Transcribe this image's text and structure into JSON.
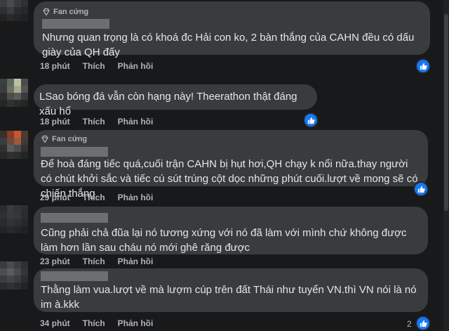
{
  "comments": [
    {
      "badge": "Fan cứng",
      "text": "Nhưng quan trọng là có khoá đc Hải con ko, 2 bàn thắng của CAHN đều có dấu giày của QH đấy",
      "time": "18 phút",
      "like": "Thích",
      "reply": "Phản hồi",
      "reactions": ""
    },
    {
      "badge": "",
      "text": "LSao bóng đá vẫn còn hạng này! Theerathon thật đáng xấu hổ",
      "time": "18 phút",
      "like": "Thích",
      "reply": "Phản hồi",
      "reactions": ""
    },
    {
      "badge": "Fan cứng",
      "text": "Để hoà đáng tiếc quá,cuối trận CAHN bị hụt hơi,QH chạy k nổi nữa.thay người có chút khởi sắc và tiếc cú sút trúng cột dọc những phút cuối.lượt về mong sẽ có chiến thắng",
      "time": "29 phút",
      "like": "Thích",
      "reply": "Phản hồi",
      "reactions": ""
    },
    {
      "badge": "",
      "text": "Cũng phải chả đũa lại nó tương xứng với nó đã làm với mình chứ không được làm hơn lần sau cháu nó mới ghê răng được",
      "time": "23 phút",
      "like": "Thích",
      "reply": "Phản hồi",
      "reactions": ""
    },
    {
      "badge": "",
      "text": "Thằng làm vua.lượt về mà lượm cúp trên đất Thái như tuyển VN.thì VN nói là nó im à.kkk",
      "time": "34 phút",
      "like": "Thích",
      "reply": "Phản hồi",
      "reactions": "2"
    }
  ],
  "colors": {
    "background": "#18191a",
    "bubble": "#3a3b3c",
    "text": "#e4e6eb",
    "secondary": "#b0b3b8",
    "like_blue": "#1877f2"
  },
  "icons": {
    "badge": "diamond-icon",
    "reaction": "thumbs-up-icon"
  }
}
